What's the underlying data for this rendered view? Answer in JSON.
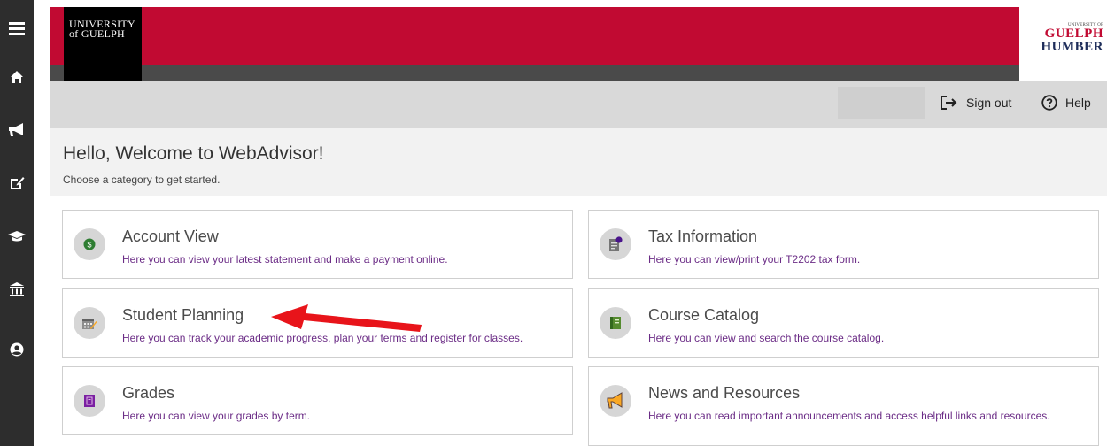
{
  "nav": {
    "items": [
      {
        "icon": "menu-icon"
      },
      {
        "icon": "home-icon"
      },
      {
        "icon": "megaphone-icon"
      },
      {
        "icon": "edit-icon"
      },
      {
        "icon": "graduation-cap-icon"
      },
      {
        "icon": "bank-icon"
      },
      {
        "icon": "user-icon"
      }
    ]
  },
  "header": {
    "left_logo": {
      "line1": "UNIVERSITY",
      "line2": "of GUELPH"
    },
    "right_logo": {
      "line0": "UNIVERSITY OF",
      "line1": "GUELPH",
      "line2": "HUMBER"
    },
    "colors": {
      "brand_red": "#c10a32",
      "bar_gray": "#4a4a4a"
    }
  },
  "toolbar": {
    "signout_label": "Sign out",
    "help_label": "Help"
  },
  "welcome": {
    "title": "Hello, Welcome to WebAdvisor!",
    "subtitle": "Choose a category to get started."
  },
  "tiles": [
    {
      "title": "Account View",
      "desc": "Here you can view your latest statement and make a payment online.",
      "icon": "money-icon"
    },
    {
      "title": "Tax Information",
      "desc": "Here you can view/print your T2202 tax form.",
      "icon": "tax-document-icon"
    },
    {
      "title": "Student Planning",
      "desc": "Here you can track your academic progress, plan your terms and register for classes.",
      "icon": "calendar-planning-icon"
    },
    {
      "title": "Course Catalog",
      "desc": "Here you can view and search the course catalog.",
      "icon": "catalog-book-icon"
    },
    {
      "title": "Grades",
      "desc": "Here you can view your grades by term.",
      "icon": "grades-book-icon"
    },
    {
      "title": "News and Resources",
      "desc": "Here you can read important announcements and access helpful links and resources.",
      "icon": "megaphone-icon"
    }
  ],
  "annotation": {
    "arrow_color": "#e8141a"
  }
}
